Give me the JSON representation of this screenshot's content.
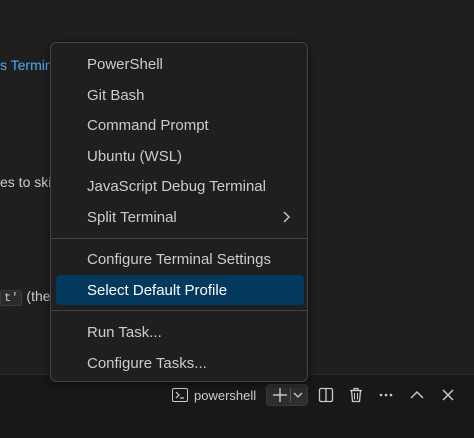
{
  "background": {
    "link_text": "s Termin",
    "line2_text": "es to ski",
    "line3_code": "t'",
    "line3_text": "(the"
  },
  "menu": {
    "items": [
      {
        "label": "PowerShell"
      },
      {
        "label": "Git Bash"
      },
      {
        "label": "Command Prompt"
      },
      {
        "label": "Ubuntu (WSL)"
      },
      {
        "label": "JavaScript Debug Terminal"
      },
      {
        "label": "Split Terminal"
      },
      {
        "label": "Configure Terminal Settings"
      },
      {
        "label": "Select Default Profile"
      },
      {
        "label": "Run Task..."
      },
      {
        "label": "Configure Tasks..."
      }
    ],
    "selected_index": 7
  },
  "panel": {
    "terminal_name": "powershell"
  },
  "colors": {
    "accent_selected": "#04395e",
    "link": "#4daafc",
    "background": "#1f1f1f"
  },
  "icons": [
    "terminal-icon",
    "plus-icon",
    "chevron-down-icon",
    "split-icon",
    "trash-icon",
    "more-icon",
    "chevron-up-icon",
    "close-icon",
    "chevron-right-icon"
  ]
}
